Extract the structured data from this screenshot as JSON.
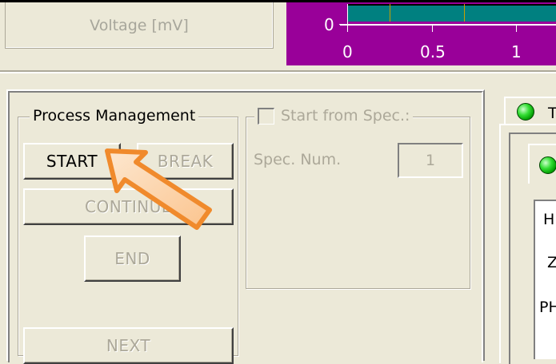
{
  "top": {
    "voltage_label": "Voltage [mV]",
    "chart_y_tick": "0",
    "chart_x_ticks": [
      "0",
      "0.5",
      "1"
    ]
  },
  "process_management": {
    "title": "Process Management",
    "start_label": "START",
    "break_label": "BREAK",
    "continue_label": "CONTINUE",
    "end_label": "END",
    "next_label": "NEXT"
  },
  "spec": {
    "checkbox_label": "Start from Spec.:",
    "checked": false,
    "num_label": "Spec. Num.",
    "num_value": "1"
  },
  "right_panel": {
    "tab_label": "T",
    "row1": "H",
    "row2": "Z",
    "row3": "PH"
  },
  "colors": {
    "window_bg": "#ece9d8",
    "chart_bg": "#990099",
    "plot_bg": "#008080",
    "arrow_fill": "#fcd7b0",
    "arrow_stroke": "#f08a2c"
  },
  "icons": {
    "status_led": "green-led-icon",
    "pointer": "orange-arrow-icon"
  }
}
